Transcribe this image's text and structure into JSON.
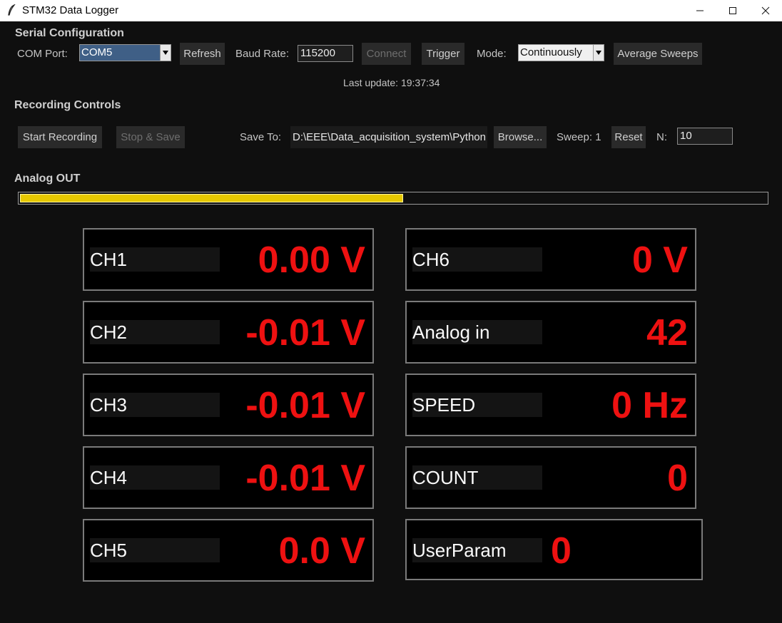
{
  "window": {
    "title": "STM32 Data Logger",
    "icon": "feather-icon"
  },
  "serial": {
    "section_title": "Serial Configuration",
    "com_port_label": "COM Port:",
    "com_port_value": "COM5",
    "refresh_label": "Refresh",
    "baud_label": "Baud Rate:",
    "baud_value": "115200",
    "connect_label": "Connect",
    "trigger_label": "Trigger",
    "mode_label": "Mode:",
    "mode_value": "Continuously",
    "average_label": "Average Sweeps",
    "last_update": "Last update: 19:37:34"
  },
  "recording": {
    "section_title": "Recording Controls",
    "start_label": "Start Recording",
    "stop_label": "Stop & Save",
    "save_to_label": "Save To:",
    "save_path": "D:\\EEE\\Data_acquisition_system\\Python",
    "browse_label": "Browse...",
    "sweep_label": "Sweep: 1",
    "reset_label": "Reset",
    "n_label": "N:",
    "n_value": "10"
  },
  "analog_out": {
    "section_title": "Analog OUT",
    "level_fraction": 0.513
  },
  "panels_left": [
    {
      "label": "CH1",
      "value": "0.00 V"
    },
    {
      "label": "CH2",
      "value": "-0.01 V"
    },
    {
      "label": "CH3",
      "value": "-0.01 V"
    },
    {
      "label": "CH4",
      "value": "-0.01 V"
    },
    {
      "label": "CH5",
      "value": "0.0 V"
    }
  ],
  "panels_right": [
    {
      "label": "CH6",
      "value": "0 V"
    },
    {
      "label": "Analog in",
      "value": "42"
    },
    {
      "label": "SPEED",
      "value": "0 Hz"
    },
    {
      "label": "COUNT",
      "value": "0"
    },
    {
      "label": "UserParam",
      "value": "0"
    }
  ],
  "colors": {
    "value_red": "#ee1111",
    "progress_yellow": "#e6c800",
    "background": "#0f0f0f",
    "combo_selected": "#3f5f86"
  }
}
